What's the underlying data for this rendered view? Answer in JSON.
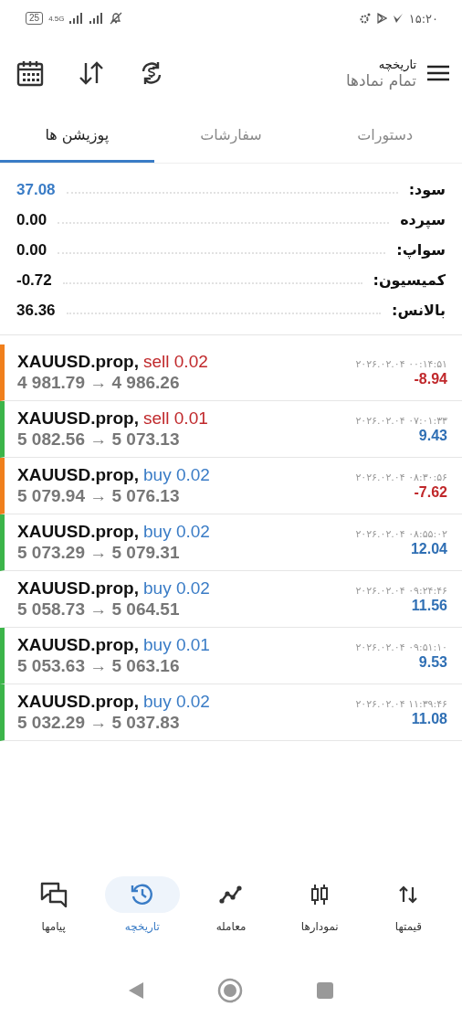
{
  "status_bar": {
    "battery": "25",
    "network": "4.5G",
    "time": "۱۵:۲۰"
  },
  "header": {
    "title": "تاریخچه",
    "subtitle": "تمام نمادها"
  },
  "tabs": [
    {
      "label": "دستورات",
      "selected": false
    },
    {
      "label": "سفارشات",
      "selected": false
    },
    {
      "label": "پوزیشن ها",
      "selected": true
    }
  ],
  "summary": [
    {
      "label": "سود:",
      "value": "37.08",
      "kind": "profit"
    },
    {
      "label": "سپرده",
      "value": "0.00",
      "kind": "plain"
    },
    {
      "label": "سواپ:",
      "value": "0.00",
      "kind": "plain"
    },
    {
      "label": "کمیسیون:",
      "value": "-0.72",
      "kind": "plain"
    },
    {
      "label": "بالانس:",
      "value": "36.36",
      "kind": "plain"
    }
  ],
  "trades": [
    {
      "symbol": "XAUUSD.prop,",
      "order": {
        "text": "sell 0.02",
        "kind": "sell"
      },
      "prices": "4 981.79 → 4 986.26",
      "time": "۲۰۲۶.۰۲.۰۴ ۰۰:۱۴:۵۱",
      "profit": {
        "text": "-8.94",
        "kind": "loss"
      },
      "color": "#f07f1c"
    },
    {
      "symbol": "XAUUSD.prop,",
      "order": {
        "text": "sell 0.01",
        "kind": "sell"
      },
      "prices": "5 082.56 → 5 073.13",
      "time": "۲۰۲۶.۰۲.۰۴ ۰۷:۰۱:۳۳",
      "profit": {
        "text": "9.43",
        "kind": "gain"
      },
      "color": "#3cb54a"
    },
    {
      "symbol": "XAUUSD.prop,",
      "order": {
        "text": "buy 0.02",
        "kind": "buy"
      },
      "prices": "5 079.94 → 5 076.13",
      "time": "۲۰۲۶.۰۲.۰۴ ۰۸:۳۰:۵۶",
      "profit": {
        "text": "-7.62",
        "kind": "loss"
      },
      "color": "#f07f1c"
    },
    {
      "symbol": "XAUUSD.prop,",
      "order": {
        "text": "buy 0.02",
        "kind": "buy"
      },
      "prices": "5 073.29 → 5 079.31",
      "time": "۲۰۲۶.۰۲.۰۴ ۰۸:۵۵:۰۲",
      "profit": {
        "text": "12.04",
        "kind": "gain"
      },
      "color": "#3cb54a"
    },
    {
      "symbol": "XAUUSD.prop,",
      "order": {
        "text": "buy 0.02",
        "kind": "buy"
      },
      "prices": "5 058.73 → 5 064.51",
      "time": "۲۰۲۶.۰۲.۰۴ ۰۹:۲۴:۴۶",
      "profit": {
        "text": "11.56",
        "kind": "gain"
      }
    },
    {
      "symbol": "XAUUSD.prop,",
      "order": {
        "text": "buy 0.01",
        "kind": "buy"
      },
      "prices": "5 053.63 → 5 063.16",
      "time": "۲۰۲۶.۰۲.۰۴ ۰۹:۵۱:۱۰",
      "profit": {
        "text": "9.53",
        "kind": "gain"
      },
      "color": "#3cb54a"
    },
    {
      "symbol": "XAUUSD.prop,",
      "order": {
        "text": "buy 0.02",
        "kind": "buy"
      },
      "prices": "5 032.29 → 5 037.83",
      "time": "۲۰۲۶.۰۲.۰۴ ۱۱:۳۹:۴۶",
      "profit": {
        "text": "11.08",
        "kind": "gain"
      },
      "color": "#3cb54a"
    }
  ],
  "bottom_nav": [
    {
      "label": "قیمتها",
      "kind": "quotes",
      "selected": false
    },
    {
      "label": "نمودارها",
      "kind": "charts",
      "selected": false
    },
    {
      "label": "معامله",
      "kind": "trade",
      "selected": false
    },
    {
      "label": "تاریخچه",
      "kind": "history",
      "selected": true
    },
    {
      "label": "پیامها",
      "kind": "messages",
      "selected": false
    }
  ]
}
